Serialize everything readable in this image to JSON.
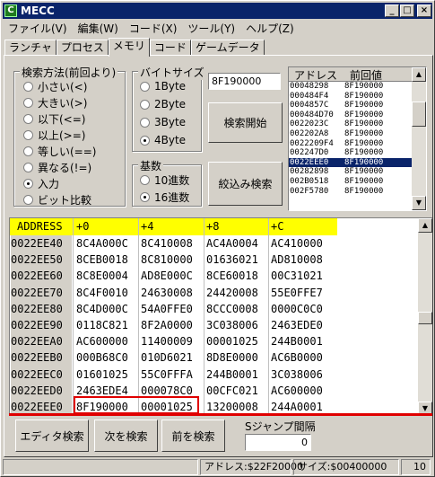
{
  "window": {
    "title": "MECC",
    "app_icon": "C",
    "controls": {
      "minimize": "_",
      "maximize": "□",
      "close": "×"
    }
  },
  "menu": [
    "ファイル(V)",
    "編集(W)",
    "コード(X)",
    "ツール(Y)",
    "ヘルプ(Z)"
  ],
  "tabs": [
    "ランチャ",
    "プロセス",
    "メモリ",
    "コード",
    "ゲームデータ"
  ],
  "active_tab": "メモリ",
  "search_method": {
    "title": "検索方法(前回より)",
    "options": [
      "小さい(<)",
      "大きい(>)",
      "以下(<=)",
      "以上(>=)",
      "等しい(==)",
      "異なる(!=)",
      "入力",
      "ビット比較"
    ],
    "selected": "入力"
  },
  "byte_size": {
    "title": "バイトサイズ",
    "options": [
      "1Byte",
      "2Byte",
      "3Byte",
      "4Byte"
    ],
    "selected": "4Byte"
  },
  "radix": {
    "title": "基数",
    "options": [
      "10進数",
      "16進数"
    ],
    "selected": "16進数"
  },
  "value_input": "8F190000",
  "buttons": {
    "search_start": "検索開始",
    "narrow_search": "絞込み検索",
    "editor_search": "エディタ検索",
    "next_search": "次を検索",
    "prev_search": "前を検索"
  },
  "results": {
    "headers": [
      "アドレス",
      "前回値"
    ],
    "rows": [
      [
        "00048298",
        "8F190000"
      ],
      [
        "000484F4",
        "8F190000"
      ],
      [
        "0004857C",
        "8F190000"
      ],
      [
        "000484D70",
        "8F190000"
      ],
      [
        "0022023C",
        "8F190000"
      ],
      [
        "002202A8",
        "8F190000"
      ],
      [
        "0022209F4",
        "8F190000"
      ],
      [
        "002247D0",
        "8F190000"
      ],
      [
        "0022EEE0",
        "8F190000"
      ],
      [
        "00282898",
        "8F190000"
      ],
      [
        "002B0518",
        "8F190000"
      ],
      [
        "002F5780",
        "8F190000"
      ]
    ],
    "selected_index": 8
  },
  "hex": {
    "headers": [
      "ADDRESS",
      "+0",
      "+4",
      "+8",
      "+C"
    ],
    "rows": [
      [
        "0022EE40",
        "8C4A000C",
        "8C410008",
        "AC4A0004",
        "AC410000"
      ],
      [
        "0022EE50",
        "8CEB0018",
        "8C810000",
        "01636021",
        "AD810008"
      ],
      [
        "0022EE60",
        "8C8E0004",
        "AD8E000C",
        "8CE60018",
        "00C31021"
      ],
      [
        "0022EE70",
        "8C4F0010",
        "24630008",
        "24420008",
        "55E0FFE7"
      ],
      [
        "0022EE80",
        "8C4D000C",
        "54A0FFE0",
        "8CCC0008",
        "0000C0C0"
      ],
      [
        "0022EE90",
        "0118C821",
        "8F2A0000",
        "3C038006",
        "2463EDE0"
      ],
      [
        "0022EEA0",
        "AC600000",
        "11400009",
        "00001025",
        "244B0001"
      ],
      [
        "0022EEB0",
        "000B68C0",
        "010D6021",
        "8D8E0000",
        "AC6B0000"
      ],
      [
        "0022EEC0",
        "01601025",
        "55C0FFFA",
        "244B0001",
        "3C038006"
      ],
      [
        "0022EED0",
        "2463EDE4",
        "000078C0",
        "00CFC021",
        "AC600000"
      ],
      [
        "0022EEE0",
        "8F190000",
        "00001025",
        "13200008",
        "244A0001"
      ]
    ]
  },
  "jump": {
    "label": "Sジャンプ間隔",
    "value": "0"
  },
  "status": {
    "address": "アドレス:$22F20000",
    "size": "サイズ:$00400000",
    "count": "10"
  },
  "colors": {
    "header_yellow": "#ffff00",
    "highlight_red": "#e00000",
    "title_blue": "#0a246a",
    "face": "#d4d0c8"
  }
}
